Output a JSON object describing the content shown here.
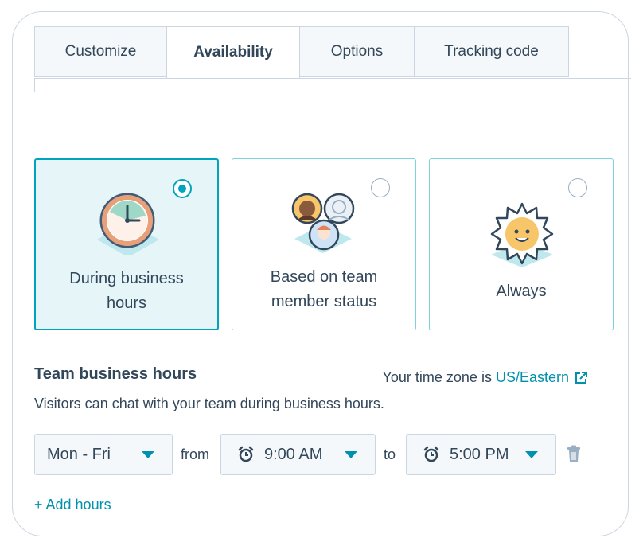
{
  "tabs": [
    {
      "label": "Customize",
      "active": false
    },
    {
      "label": "Availability",
      "active": true
    },
    {
      "label": "Options",
      "active": false
    },
    {
      "label": "Tracking code",
      "active": false
    }
  ],
  "options": [
    {
      "label_line1": "During business",
      "label_line2": "hours",
      "selected": true,
      "icon": "clock-icon"
    },
    {
      "label_line1": "Based on team",
      "label_line2": "member status",
      "selected": false,
      "icon": "team-avatars-icon"
    },
    {
      "label_line1": "Always",
      "label_line2": "",
      "selected": false,
      "icon": "sun-icon"
    }
  ],
  "business_hours": {
    "title": "Team business hours",
    "timezone_prefix": "Your time zone is",
    "timezone": "US/Eastern",
    "description": "Visitors can chat with your team during business hours.",
    "days": "Mon - Fri",
    "from_label": "from",
    "from_time": "9:00 AM",
    "to_label": "to",
    "to_time": "5:00 PM",
    "add_hours": "+ Add hours"
  },
  "colors": {
    "accent": "#00a4bd",
    "link": "#0091ae",
    "text": "#33475b",
    "border": "#cbd6e2"
  }
}
